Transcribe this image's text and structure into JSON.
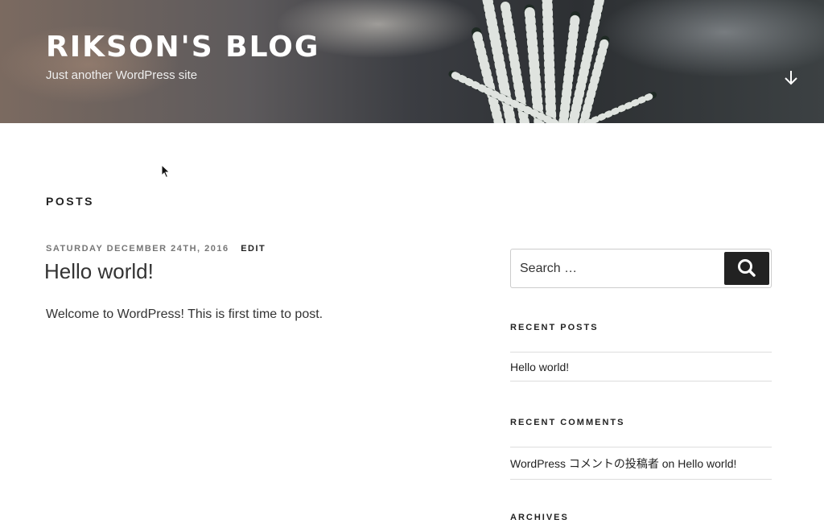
{
  "site": {
    "title": "RIKSON'S BLOG",
    "description": "Just another WordPress site"
  },
  "main": {
    "section_label": "POSTS",
    "post": {
      "date": "SATURDAY DECEMBER 24TH, 2016",
      "edit_label": "EDIT",
      "title": "Hello world!",
      "body": "Welcome to WordPress! This is first time to post."
    }
  },
  "sidebar": {
    "search": {
      "placeholder": "Search …"
    },
    "recent_posts": {
      "title": "RECENT POSTS",
      "items": [
        {
          "label": "Hello world!"
        }
      ]
    },
    "recent_comments": {
      "title": "RECENT COMMENTS",
      "items": [
        {
          "author": "WordPress コメントの投稿者",
          "on": "on",
          "post": "Hello world!"
        }
      ]
    },
    "archives": {
      "title": "ARCHIVES"
    }
  },
  "icons": {
    "scroll_down": "arrow-down-icon",
    "search": "search-icon",
    "cursor": "mouse-cursor-icon"
  },
  "colors": {
    "text": "#222222",
    "meta": "#767676",
    "search_button": "#222222",
    "divider": "#dddddd"
  }
}
